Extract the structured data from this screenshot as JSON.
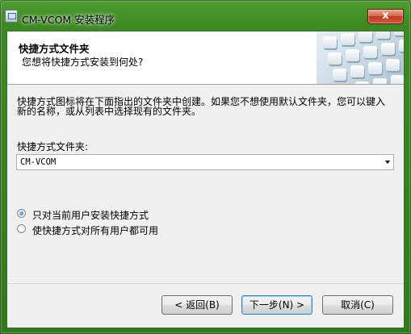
{
  "window": {
    "title": "CM-VCOM 安装程序",
    "close_label": "x"
  },
  "header": {
    "title": "快捷方式文件夹",
    "subtitle": "您想将快捷方式安装到何处?"
  },
  "main": {
    "description_line1": "快捷方式图标将在下面指出的文件夹中创建。如果您不想使用默认文件夹，您可以键入",
    "description_line2": "新的名称，或从列表中选择现有的文件夹。",
    "folder_label": "快捷方式文件夹:",
    "folder_value": "CM-VCOM",
    "options": [
      {
        "label": "只对当前用户安装快捷方式",
        "checked": true
      },
      {
        "label": "使快捷方式对所有用户都可用",
        "checked": false
      }
    ]
  },
  "buttons": {
    "back": "< 返回(B)",
    "next": "下一步(N) >",
    "cancel": "取消(C)"
  }
}
